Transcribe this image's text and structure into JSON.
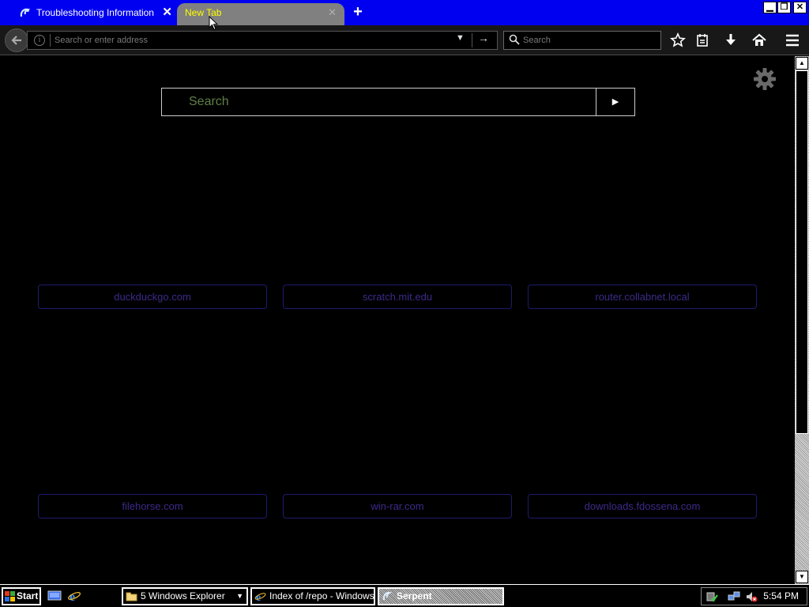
{
  "tabs": [
    {
      "title": "Troubleshooting Information",
      "close": "✕"
    },
    {
      "title": "New Tab",
      "close": "✕"
    }
  ],
  "newtab_label": "+",
  "window_controls": {
    "minimize": "▁",
    "maximize": "❐",
    "close": "✕"
  },
  "navbar": {
    "url_placeholder": "Search or enter address",
    "search_placeholder": "Search"
  },
  "ntp": {
    "search_placeholder": "Search",
    "search_button": "▶",
    "tiles": [
      {
        "label": "duckduckgo.com"
      },
      {
        "label": "scratch.mit.edu"
      },
      {
        "label": "router.collabnet.local"
      },
      {
        "label": "filehorse.com"
      },
      {
        "label": "win-rar.com"
      },
      {
        "label": "downloads.fdossena.com"
      }
    ]
  },
  "taskbar": {
    "start_label": "Start",
    "tasks": [
      {
        "label": "5 Windows Explorer",
        "icon": "folder-icon"
      },
      {
        "label": "Index of /repo - Windows...",
        "icon": "ie-icon"
      },
      {
        "label": "Serpent",
        "icon": "serpent-icon"
      }
    ],
    "clock": "5:54 PM"
  },
  "colors": {
    "tabstrip": "#0000f0",
    "active_tab": "#808080",
    "active_tab_text": "#ffff00",
    "tile_border": "#1c1c6e",
    "tile_text": "#3d2a8a",
    "search_text": "#5f7f46"
  }
}
